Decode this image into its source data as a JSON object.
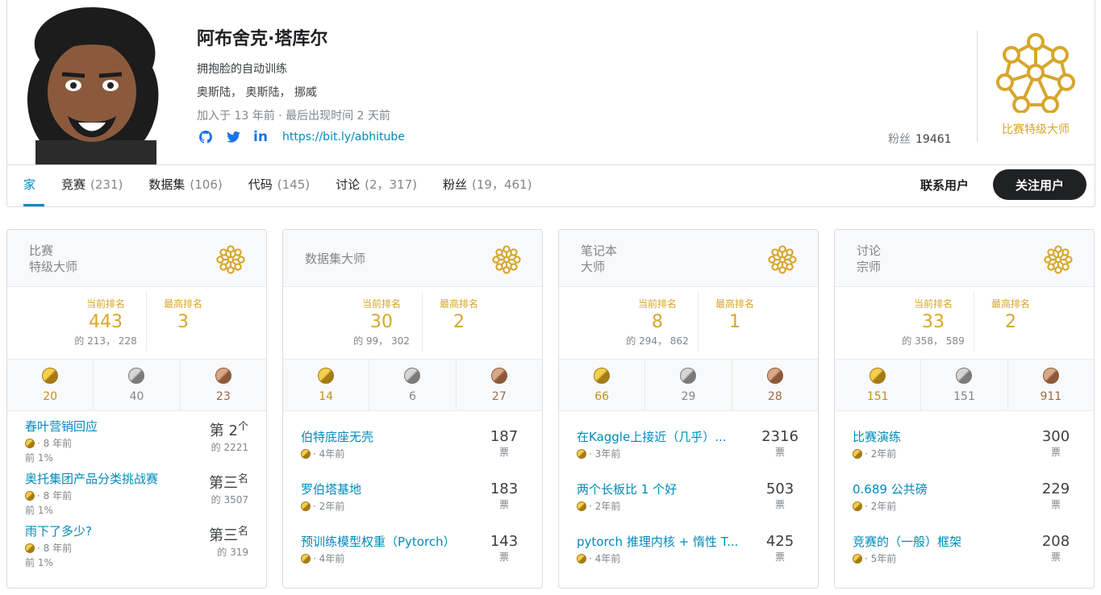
{
  "profile": {
    "name": "阿布舍克·塔库尔",
    "bio": "拥抱脸的自动训练",
    "location": "奥斯陆， 奥斯陆， 挪威",
    "joined": "加入于 13 年前 · 最后出现时间 2 天前",
    "link": "https://bit.ly/abhitube",
    "followers_label": "粉丝",
    "followers_count": "19461",
    "tier": "比赛特级大师"
  },
  "tabs": [
    {
      "label": "家",
      "count": ""
    },
    {
      "label": "竞赛",
      "count": "(231)"
    },
    {
      "label": "数据集",
      "count": "(106)"
    },
    {
      "label": "代码",
      "count": "(145)"
    },
    {
      "label": "讨论",
      "count": "(2，317)"
    },
    {
      "label": "粉丝",
      "count": "(19，461)"
    }
  ],
  "actions": {
    "contact": "联系用户",
    "follow": "关注用户"
  },
  "cards": [
    {
      "title": "比赛\n特级大师",
      "current_label": "当前排名",
      "current": "443",
      "of": "的 213， 228",
      "best_label": "最高排名",
      "best": "3",
      "medals": {
        "gold": "20",
        "silver": "40",
        "bronze": "23"
      },
      "items": [
        {
          "title": "春叶营销回应",
          "meta": "· 8 年前",
          "pct": "前 1%",
          "place": "第 2",
          "sup": "个",
          "of": "的 2221"
        },
        {
          "title": "奥托集团产品分类挑战赛",
          "meta": "· 8 年前",
          "pct": "前 1%",
          "place": "第三",
          "sup": "名",
          "of": "的 3507"
        },
        {
          "title": "雨下了多少?",
          "meta": "· 8 年前",
          "pct": "前 1%",
          "place": "第三",
          "sup": "名",
          "of": "的 319"
        }
      ]
    },
    {
      "title": "数据集大师",
      "current_label": "当前排名",
      "current": "30",
      "of": "的 99， 302",
      "best_label": "最高排名",
      "best": "2",
      "medals": {
        "gold": "14",
        "silver": "6",
        "bronze": "27"
      },
      "items": [
        {
          "title": "伯特底座无壳",
          "meta": "· 4年前",
          "votes": "187",
          "vlabel": "票"
        },
        {
          "title": "罗伯塔基地",
          "meta": "· 2年前",
          "votes": "183",
          "vlabel": "票"
        },
        {
          "title": "预训练模型权重（Pytorch）",
          "meta": "· 4年前",
          "votes": "143",
          "vlabel": "票"
        }
      ]
    },
    {
      "title": "笔记本\n大师",
      "current_label": "当前排名",
      "current": "8",
      "of": "的 294， 862",
      "best_label": "最高排名",
      "best": "1",
      "medals": {
        "gold": "66",
        "silver": "29",
        "bronze": "28"
      },
      "items": [
        {
          "title": "在Kaggle上接近（几乎）...",
          "meta": "· 3年前",
          "votes": "2316",
          "vlabel": "票"
        },
        {
          "title": "两个长板比 1 个好",
          "meta": "· 2年前",
          "votes": "503",
          "vlabel": "票"
        },
        {
          "title": "pytorch 推理内核 + 惰性 T...",
          "meta": "· 4年前",
          "votes": "425",
          "vlabel": "票"
        }
      ]
    },
    {
      "title": "讨论\n宗师",
      "current_label": "当前排名",
      "current": "33",
      "of": "的 358， 589",
      "best_label": "最高排名",
      "best": "2",
      "medals": {
        "gold": "151",
        "silver": "151",
        "bronze": "911"
      },
      "items": [
        {
          "title": "比赛演练",
          "meta": "· 2年前",
          "votes": "300",
          "vlabel": "票"
        },
        {
          "title": "0.689 公共磅",
          "meta": "· 2年前",
          "votes": "229",
          "vlabel": "票"
        },
        {
          "title": "竞赛的（一般）框架",
          "meta": "· 5年前",
          "votes": "208",
          "vlabel": "票"
        }
      ]
    }
  ],
  "colors": {
    "accent": "#008abc",
    "gold": "#d7a62b",
    "dark": "#202124"
  }
}
